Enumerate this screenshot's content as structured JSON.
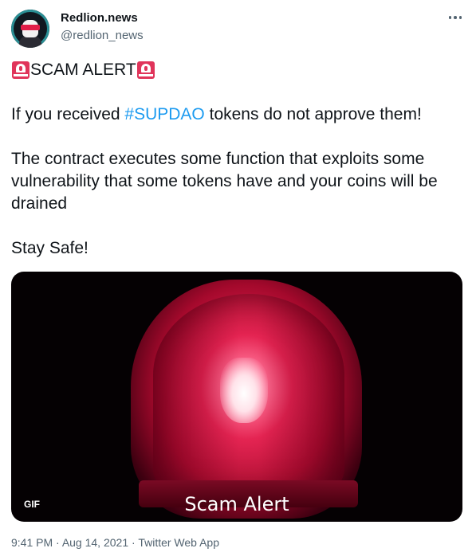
{
  "author": {
    "name": "Redlion.news",
    "handle": "@redlion_news"
  },
  "tweet": {
    "line1_text": "SCAM ALERT",
    "line2_before": "If you received ",
    "line2_hashtag": "#SUPDAO",
    "line2_after": " tokens do not approve them!",
    "line3": "The contract executes some function that exploits some vulnerability that some tokens have and your coins will be drained",
    "line4": "Stay Safe!"
  },
  "media": {
    "badge": "GIF",
    "caption": "Scam Alert"
  },
  "meta": {
    "time": "9:41 PM",
    "separator1": " · ",
    "date": "Aug 14, 2021",
    "separator2": " · ",
    "source": "Twitter Web App"
  },
  "colors": {
    "link": "#1d9bf0",
    "muted": "#536471",
    "text": "#0f1419"
  },
  "icons": {
    "siren": "police-car-light-emoji",
    "more": "more-horizontal-icon"
  }
}
